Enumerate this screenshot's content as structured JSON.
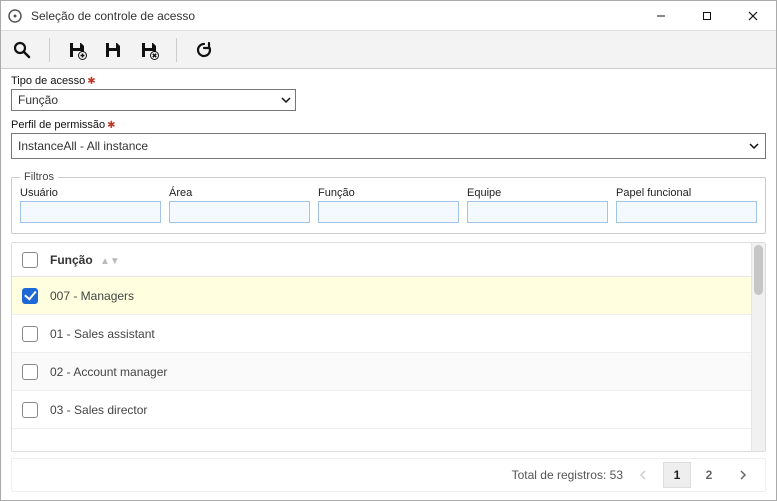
{
  "window": {
    "title": "Seleção de controle de acesso"
  },
  "form": {
    "accessTypeLabel": "Tipo de acesso",
    "accessTypeValue": "Função",
    "permissionProfileLabel": "Perfil de permissão",
    "permissionProfileValue": "InstanceAll - All instance"
  },
  "filters": {
    "legend": "Filtros",
    "cols": {
      "user": "Usuário",
      "area": "Área",
      "function": "Função",
      "team": "Equipe",
      "functionalRole": "Papel funcional"
    }
  },
  "list": {
    "header": "Função",
    "rows": [
      {
        "label": "007 - Managers",
        "checked": true
      },
      {
        "label": "01 - Sales assistant",
        "checked": false
      },
      {
        "label": "02 - Account manager",
        "checked": false
      },
      {
        "label": "03 - Sales director",
        "checked": false
      }
    ]
  },
  "footer": {
    "totalLabel": "Total de registros: 53",
    "pages": [
      "1",
      "2"
    ],
    "activePage": "1"
  }
}
